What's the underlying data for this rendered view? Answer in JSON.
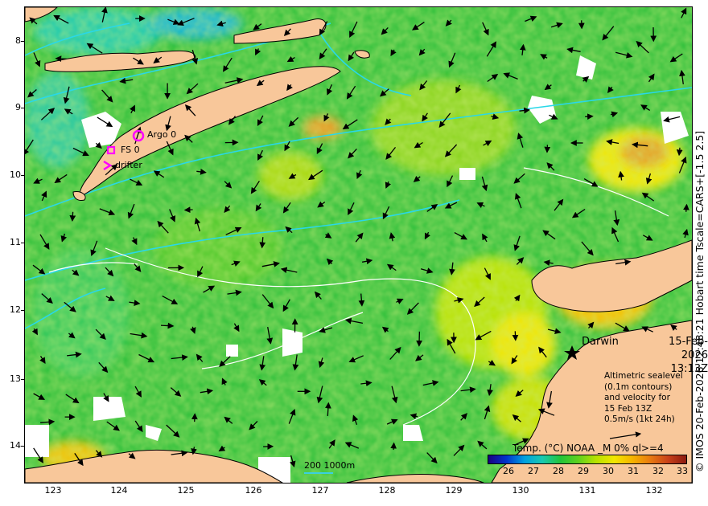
{
  "map": {
    "y_ticks": [
      "8",
      "9",
      "10",
      "11",
      "12",
      "13",
      "14"
    ],
    "x_ticks": [
      "123",
      "124",
      "125",
      "126",
      "127",
      "128",
      "129",
      "130",
      "131",
      "132"
    ],
    "credit": "© IMOS 20-Feb-2026 12:48:21 Hobart time Tscale=CARS+[-1.5 2.5]",
    "markers": {
      "argo": "Argo 0",
      "fs": "FS 0",
      "drifter": "drifter",
      "marker_color": "#ff00ff"
    },
    "city_label": "Darwin",
    "date_line1": "15-Feb-2026",
    "date_line2": "13:13Z",
    "info_lines": [
      "Altimetric sealevel",
      "(0.1m contours)",
      "and velocity for",
      "15 Feb 13Z",
      "0.5m/s (1kt 24h)"
    ],
    "colorbar": {
      "title": "Temp. (°C) NOAA _M 0% ql>=4",
      "ticks": [
        "26",
        "27",
        "28",
        "29",
        "30",
        "31",
        "32",
        "33"
      ],
      "colors": [
        "#1a0080",
        "#0033cc",
        "#00a0e0",
        "#19c9b0",
        "#22c43a",
        "#5fd11e",
        "#b8e200",
        "#f2e600",
        "#f5b400",
        "#e87a10",
        "#c8401a",
        "#8b1a10"
      ]
    },
    "scale_label": "200  1000m",
    "land_color": "#f8c79a",
    "ocean_color": "#2dbf3a",
    "contour_color": "#29d8e8"
  }
}
